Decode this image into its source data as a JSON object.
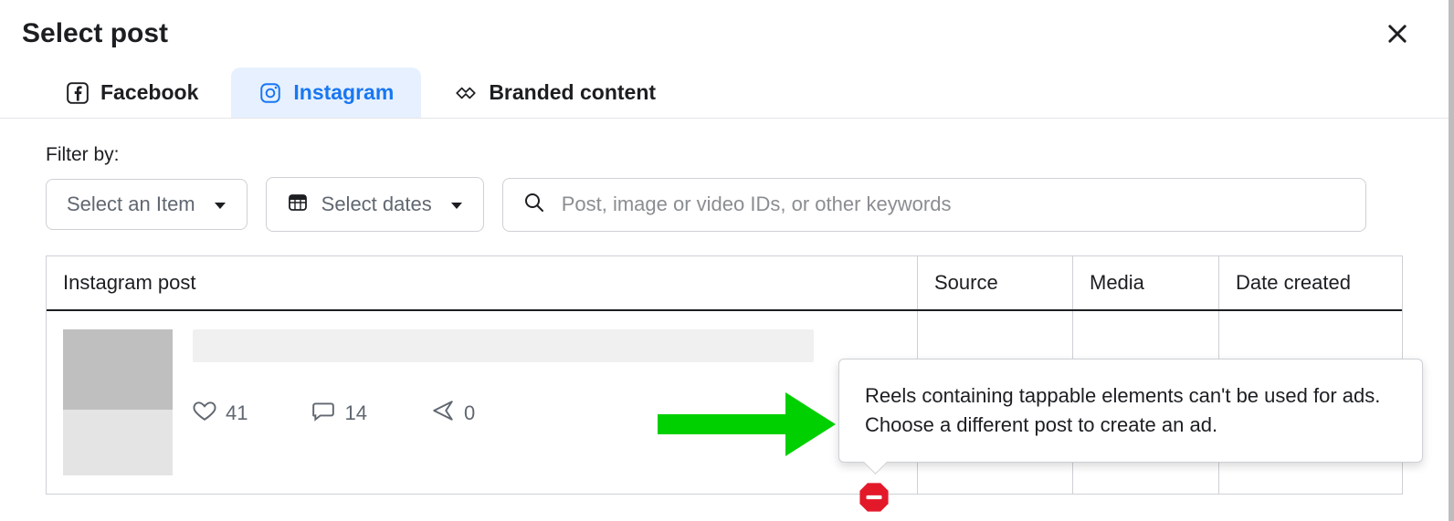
{
  "header": {
    "title": "Select post"
  },
  "tabs": {
    "facebook": "Facebook",
    "instagram": "Instagram",
    "branded": "Branded content",
    "active": "instagram"
  },
  "filter": {
    "label": "Filter by:",
    "item_dropdown": "Select an Item",
    "dates_dropdown": "Select dates",
    "search_placeholder": "Post, image or video IDs, or other keywords"
  },
  "table": {
    "headers": {
      "post": "Instagram post",
      "source": "Source",
      "media": "Media",
      "date": "Date created"
    },
    "row": {
      "likes": "41",
      "comments": "14",
      "shares": "0"
    }
  },
  "tooltip": {
    "text": "Reels containing tappable elements can't be used for ads. Choose a different post to create an ad."
  }
}
